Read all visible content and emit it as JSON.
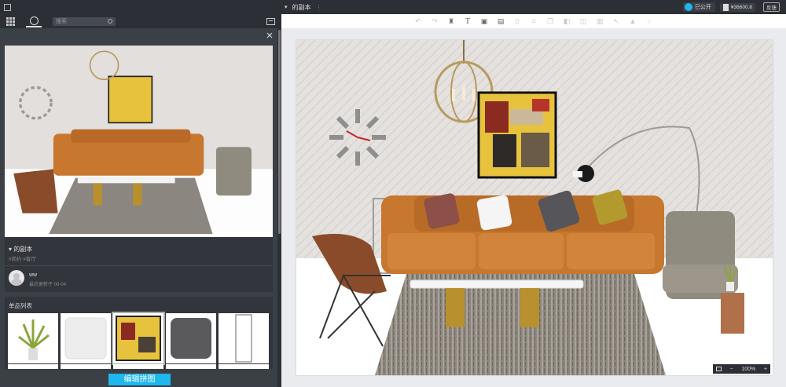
{
  "left_panel": {
    "search_placeholder": "搜索",
    "scheme_title": "的副本",
    "scheme_tags": "#简约 #客厅",
    "user_name": "ww",
    "user_time": "最后更新于 08-04",
    "products_title": "单品列表",
    "edit_button": "编辑拼图"
  },
  "header": {
    "doc_title": "的副本",
    "public_label": "已公开",
    "price": "¥36600.8",
    "feedback": "反馈"
  },
  "toolbar": {
    "icons": [
      "undo-icon",
      "redo-icon",
      "brush-icon",
      "text-icon",
      "image-icon",
      "crop-image-icon",
      "trash-icon",
      "crop-icon",
      "copy-icon",
      "flip-icon",
      "layers-icon",
      "paint-icon",
      "magic-wand-icon",
      "lock-icon",
      "info-icon"
    ]
  },
  "zoom": {
    "minus": "−",
    "value": "100%",
    "plus": "+"
  },
  "colors": {
    "accent": "#1fb7ee",
    "sofa": "#c8772e",
    "panel_dark": "#2c2f35"
  }
}
